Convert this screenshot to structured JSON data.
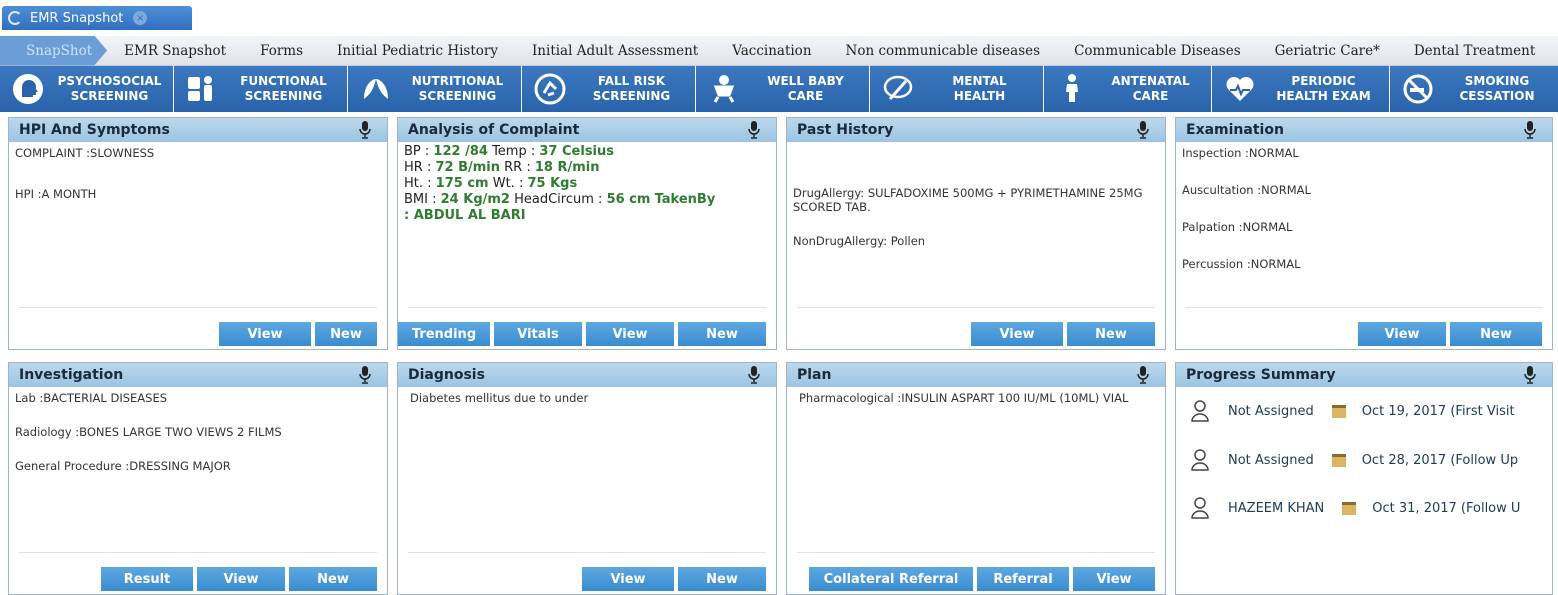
{
  "window": {
    "title": "EMR Snapshot"
  },
  "nav": {
    "tabs": [
      "SnapShot",
      "EMR Snapshot",
      "Forms",
      "Initial Pediatric History",
      "Initial Adult Assessment",
      "Vaccination",
      "Non communicable diseases",
      "Communicable Diseases",
      "Geriatric Care*",
      "Dental Treatment"
    ]
  },
  "screening": [
    {
      "line1": "PSYCHOSOCIAL",
      "line2": "SCREENING",
      "icon": "head-icon"
    },
    {
      "line1": "FUNCTIONAL",
      "line2": "SCREENING",
      "icon": "person-icon"
    },
    {
      "line1": "NUTRITIONAL",
      "line2": "SCREENING",
      "icon": "leaf-icon"
    },
    {
      "line1": "FALL RISK",
      "line2": "SCREENING",
      "icon": "fall-icon"
    },
    {
      "line1": "WELL BABY",
      "line2": "CARE",
      "icon": "baby-icon"
    },
    {
      "line1": "MENTAL",
      "line2": "HEALTH",
      "icon": "brain-icon"
    },
    {
      "line1": "ANTENATAL",
      "line2": "CARE",
      "icon": "pregnant-icon"
    },
    {
      "line1": "PERIODIC",
      "line2": "HEALTH EXAM",
      "icon": "heart-icon"
    },
    {
      "line1": "SMOKING",
      "line2": "CESSATION",
      "icon": "no-smoking-icon"
    }
  ],
  "panels": {
    "hpi": {
      "title": "HPI And Symptoms",
      "lines": [
        "COMPLAINT :SLOWNESS",
        "HPI :A MONTH"
      ],
      "buttons": [
        "View",
        "New"
      ]
    },
    "analysis": {
      "title": "Analysis of Complaint",
      "vitals": {
        "bp_label": "BP :",
        "bp_value": "122 /84",
        "temp_label": "Temp :",
        "temp_value": "37 Celsius",
        "hr_label": "HR :",
        "hr_value": "72 B/min",
        "rr_label": "RR :",
        "rr_value": "18 R/min",
        "ht_label": "Ht. :",
        "ht_value": "175 cm",
        "wt_label": "Wt. :",
        "wt_value": "75 Kgs",
        "bmi_label": "BMI :",
        "bmi_value": "24 Kg/m2",
        "hc_label": "HeadCircum :",
        "hc_value": "56 cm",
        "takenby_label": "TakenBy",
        "takenby_value": ": ABDUL AL BARI"
      },
      "buttons": [
        "Trending",
        "Vitals",
        "View",
        "New"
      ]
    },
    "past": {
      "title": "Past History",
      "lines": [
        "DrugAllergy: SULFADOXIME 500MG + PYRIMETHAMINE 25MG SCORED TAB.",
        "NonDrugAllergy: Pollen"
      ],
      "buttons": [
        "View",
        "New"
      ]
    },
    "exam": {
      "title": "Examination",
      "lines": [
        "Inspection :NORMAL",
        "Auscultation :NORMAL",
        "Palpation :NORMAL",
        "Percussion :NORMAL"
      ],
      "buttons": [
        "View",
        "New"
      ]
    },
    "investigation": {
      "title": "Investigation",
      "lines": [
        "Lab :BACTERIAL DISEASES",
        "Radiology :BONES LARGE TWO VIEWS 2 FILMS",
        "General Procedure :DRESSING MAJOR"
      ],
      "buttons": [
        "Result",
        "View",
        "New"
      ]
    },
    "diagnosis": {
      "title": "Diagnosis",
      "lines": [
        "Diabetes mellitus due to under"
      ],
      "buttons": [
        "View",
        "New"
      ]
    },
    "plan": {
      "title": "Plan",
      "lines": [
        "Pharmacological :INSULIN ASPART 100 IU/ML (10ML) VIAL"
      ],
      "buttons": [
        "Collateral Referral",
        "Referral",
        "View"
      ]
    },
    "progress": {
      "title": "Progress Summary",
      "items": [
        {
          "name": "Not Assigned",
          "date": "Oct 19, 2017 (First Visit"
        },
        {
          "name": "Not Assigned",
          "date": "Oct 28, 2017 (Follow Up"
        },
        {
          "name": "HAZEEM  KHAN",
          "date": "Oct 31, 2017 (Follow U"
        }
      ]
    }
  }
}
